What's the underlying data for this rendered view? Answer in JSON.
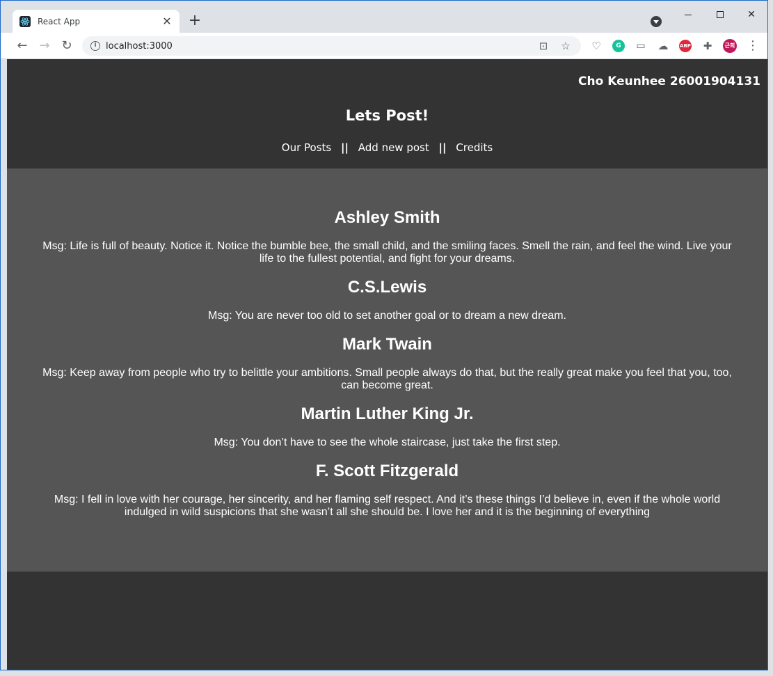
{
  "browser": {
    "tab_title": "React App",
    "url": "localhost:3000",
    "extensions": [
      {
        "name": "grammarly-icon",
        "label": "G",
        "color": "#15c39a"
      },
      {
        "name": "adblock-icon",
        "label": "ABP",
        "color": "#e0283d"
      },
      {
        "name": "profile-avatar",
        "label": "근희",
        "color": "#c2185b"
      }
    ]
  },
  "header": {
    "author": "Cho Keunhee 26001904131",
    "title": "Lets Post!",
    "nav": {
      "our_posts": "Our Posts",
      "add_new_post": "Add new post",
      "credits": "Credits",
      "separator": "||"
    }
  },
  "posts": [
    {
      "name": "Ashley Smith",
      "msg": "Msg: Life is full of beauty. Notice it. Notice the bumble bee, the small child, and the smiling faces. Smell the rain, and feel the wind. Live your life to the fullest potential, and fight for your dreams."
    },
    {
      "name": "C.S.Lewis",
      "msg": "Msg: You are never too old to set another goal or to dream a new dream."
    },
    {
      "name": "Mark Twain",
      "msg": "Msg: Keep away from people who try to belittle your ambitions. Small people always do that, but the really great make you feel that you, too, can become great."
    },
    {
      "name": "Martin Luther King Jr.",
      "msg": "Msg: You don’t have to see the whole staircase, just take the first step."
    },
    {
      "name": "F. Scott Fitzgerald",
      "msg": "Msg: I fell in love with her courage, her sincerity, and her flaming self respect. And it’s these things I’d believe in, even if the whole world indulged in wild suspicions that she wasn’t all she should be. I love her and it is the beginning of everything"
    }
  ],
  "colors": {
    "page_bg": "#333333",
    "content_bg": "#555555",
    "text": "#ffffff"
  }
}
